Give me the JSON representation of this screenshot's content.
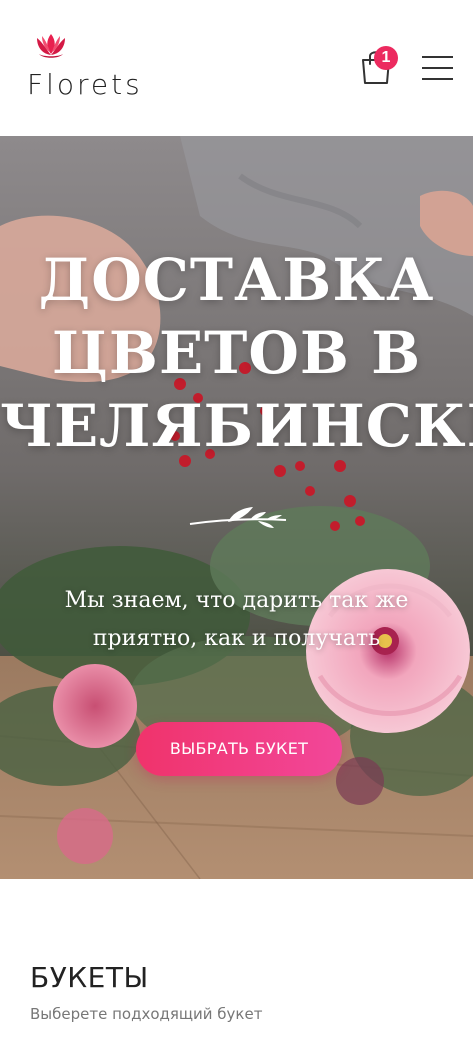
{
  "header": {
    "logo_text": "Florets",
    "cart_count": "1",
    "brand_color": "#ec2a5f"
  },
  "hero": {
    "title_lines": [
      "ДОСТАВКА",
      "ЦВЕТОВ В",
      "ЧЕЛЯБИНСКЕ"
    ],
    "subtitle_line1": "Мы знаем, что дарить так же",
    "subtitle_line2": "приятно, как и получать",
    "button_label": "ВЫБРАТЬ БУКЕТ",
    "button_colors": [
      "#f0336b",
      "#f2479a"
    ]
  },
  "bouquets": {
    "title": "БУКЕТЫ",
    "subtitle": "Выберете подходящий букет"
  },
  "icons": [
    "logo-flower-icon",
    "shopping-bag-icon",
    "hamburger-menu-icon",
    "leaf-divider-icon"
  ]
}
